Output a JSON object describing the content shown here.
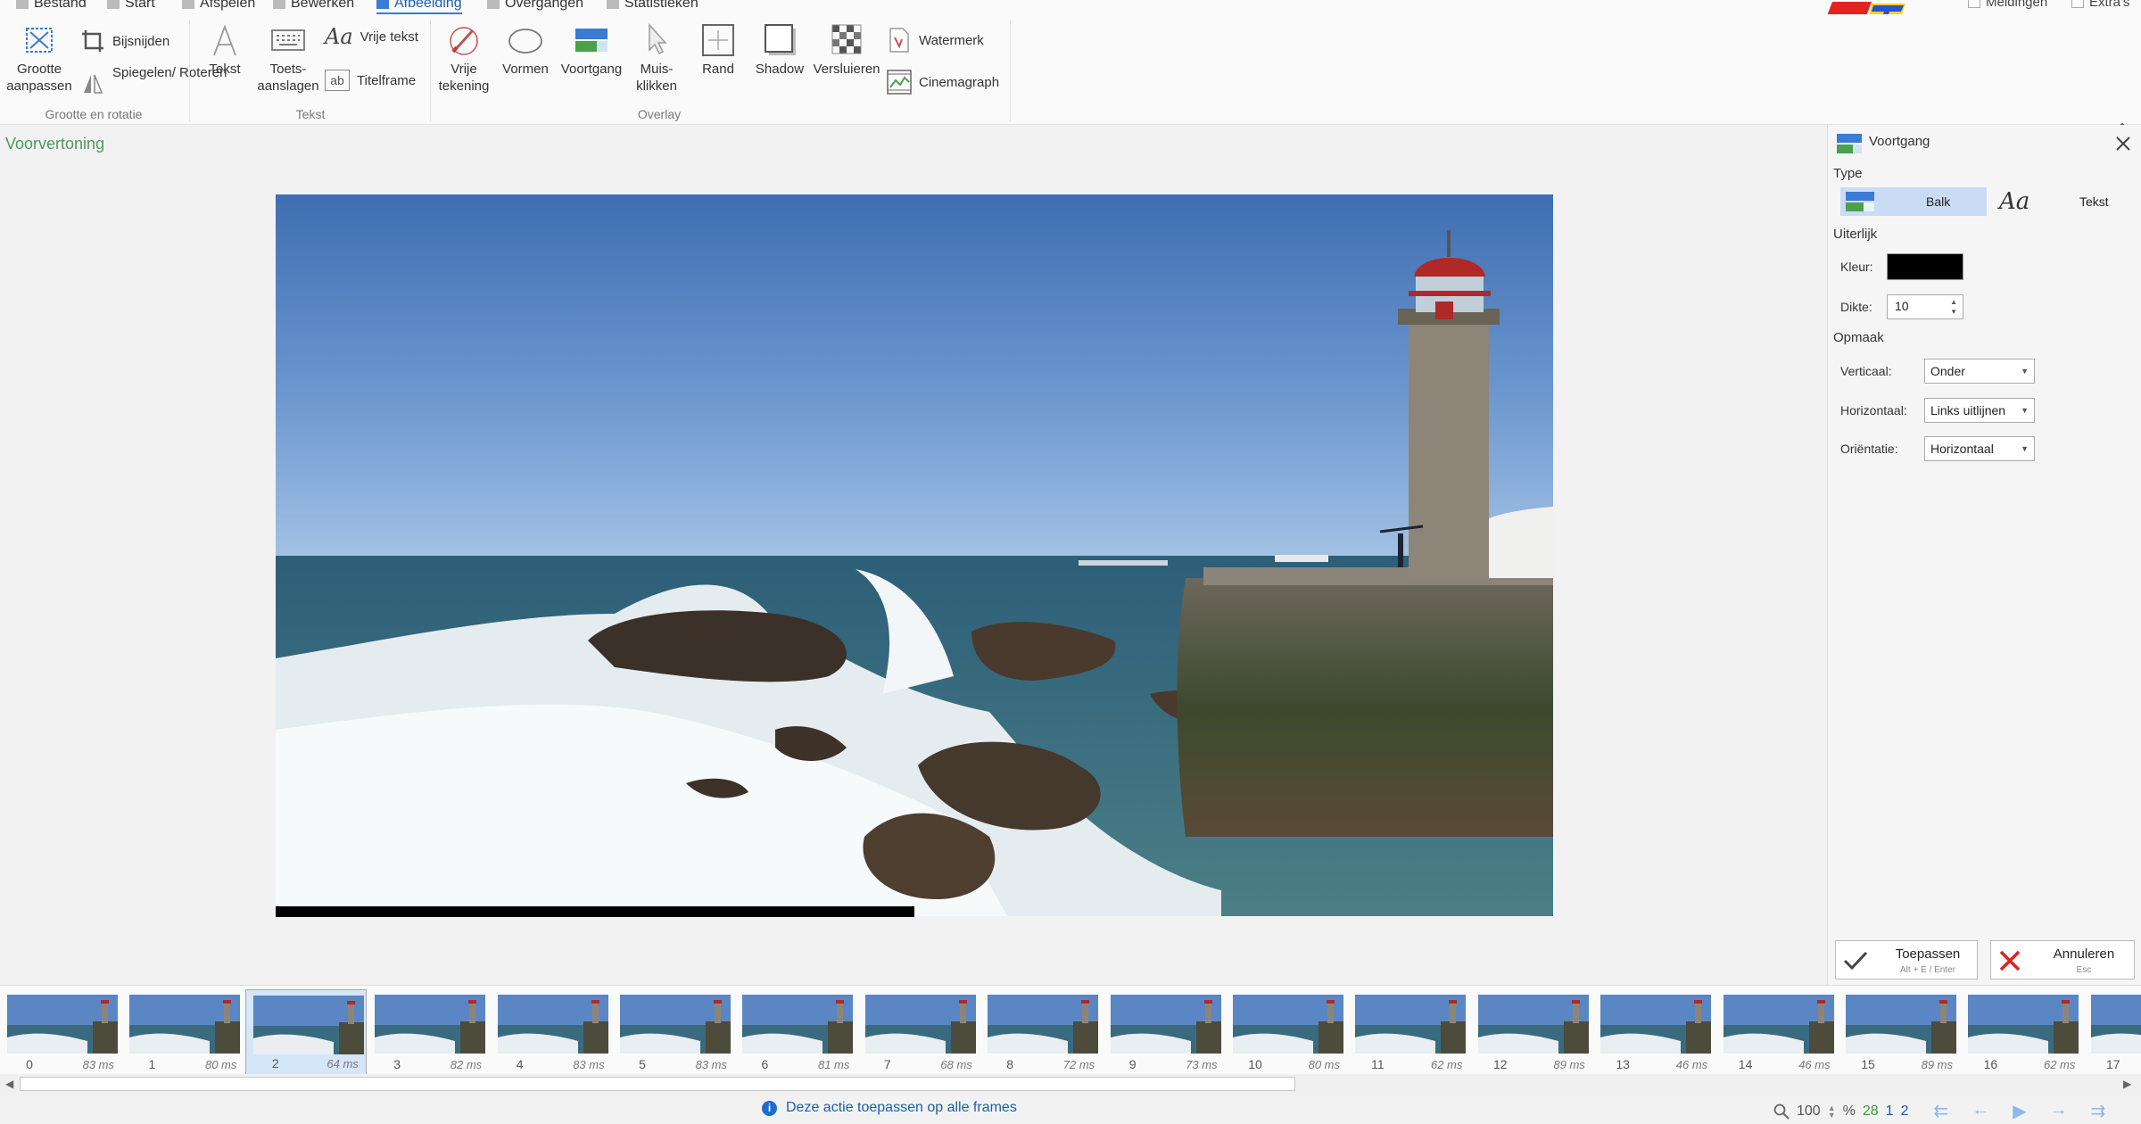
{
  "menu": {
    "items": [
      {
        "label": "Bestand",
        "icon": "save-icon"
      },
      {
        "label": "Start",
        "icon": "home-icon"
      },
      {
        "label": "Afspelen",
        "icon": "play-icon"
      },
      {
        "label": "Bewerken",
        "icon": "pencil-icon"
      },
      {
        "label": "Afbeelding",
        "icon": "image-icon",
        "active": true
      },
      {
        "label": "Overgangen",
        "icon": "transition-icon"
      },
      {
        "label": "Statistieken",
        "icon": "info-icon"
      }
    ],
    "notifications_label": "Meldingen",
    "extras_label": "Extra's"
  },
  "ribbon": {
    "resize_label": "Grootte aanpassen",
    "crop_label": "Bijsnijden",
    "flip_label": "Spiegelen/ Roteren",
    "group_size": "Grootte en rotatie",
    "text_label": "Tekst",
    "keystrokes_label": "Toets- aanslagen",
    "free_text_label": "Vrije tekst",
    "title_frame_label": "Titelframe",
    "group_text": "Tekst",
    "free_drawing_label": "Vrije tekening",
    "shapes_label": "Vormen",
    "progress_label": "Voortgang",
    "mouse_clicks_label": "Muis- klikken",
    "border_label": "Rand",
    "shadow_label": "Shadow",
    "obfuscate_label": "Versluieren",
    "watermark_label": "Watermerk",
    "cinemagraph_label": "Cinemagraph",
    "group_overlay": "Overlay"
  },
  "preview": {
    "label": "Voorvertoning",
    "progress_fraction": 0.5
  },
  "panel": {
    "title": "Voortgang",
    "type_label": "Type",
    "type_bar": "Balk",
    "type_text": "Tekst",
    "appearance_label": "Uiterlijk",
    "color_label": "Kleur:",
    "color_value": "#000000",
    "thickness_label": "Dikte:",
    "thickness_value": "10",
    "layout_label": "Opmaak",
    "vertical_label": "Verticaal:",
    "vertical_value": "Onder",
    "horizontal_label": "Horizontaal:",
    "horizontal_value": "Links uitlijnen",
    "orientation_label": "Oriëntatie:",
    "orientation_value": "Horizontaal",
    "apply_label": "Toepassen",
    "apply_hint": "Alt + E / Enter",
    "cancel_label": "Annuleren",
    "cancel_hint": "Esc"
  },
  "frames": [
    {
      "num": "0",
      "ms": "83 ms"
    },
    {
      "num": "1",
      "ms": "80 ms"
    },
    {
      "num": "2",
      "ms": "64 ms",
      "selected": true
    },
    {
      "num": "3",
      "ms": "82 ms"
    },
    {
      "num": "4",
      "ms": "83 ms"
    },
    {
      "num": "5",
      "ms": "83 ms"
    },
    {
      "num": "6",
      "ms": "81 ms"
    },
    {
      "num": "7",
      "ms": "68 ms"
    },
    {
      "num": "8",
      "ms": "72 ms"
    },
    {
      "num": "9",
      "ms": "73 ms"
    },
    {
      "num": "10",
      "ms": "80 ms"
    },
    {
      "num": "11",
      "ms": "62 ms"
    },
    {
      "num": "12",
      "ms": "89 ms"
    },
    {
      "num": "13",
      "ms": "46 ms"
    },
    {
      "num": "14",
      "ms": "46 ms"
    },
    {
      "num": "15",
      "ms": "89 ms"
    },
    {
      "num": "16",
      "ms": "62 ms"
    },
    {
      "num": "17",
      "ms": ""
    }
  ],
  "status": {
    "message": "Deze actie toepassen op alle frames",
    "zoom": "100",
    "zoom_unit": "%",
    "frame_count": "28",
    "selected_count": "1",
    "current_frame": "2"
  },
  "colors": {
    "accent": "#1b5fa8",
    "preview_label": "#4a9a5a",
    "selected_segment": "#c9dcf3",
    "cancel_red": "#e02020",
    "apply_check": "#444444"
  }
}
